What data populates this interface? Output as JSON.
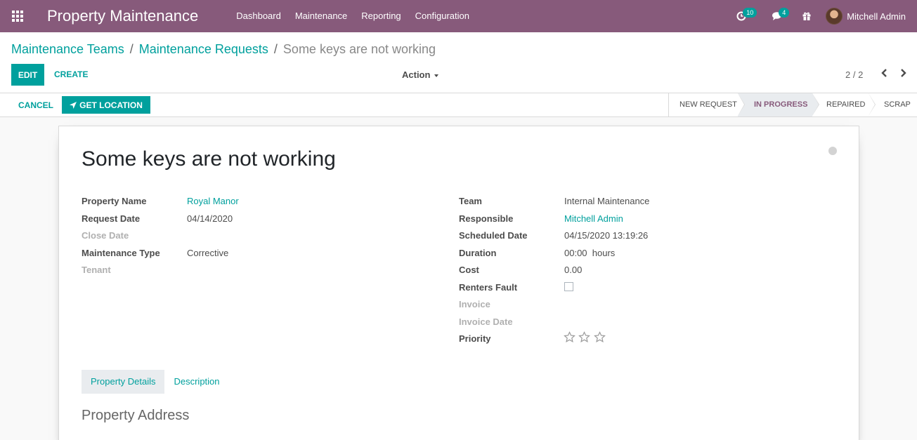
{
  "navbar": {
    "brand": "Property Maintenance",
    "menu": [
      {
        "label": "Dashboard"
      },
      {
        "label": "Maintenance"
      },
      {
        "label": "Reporting"
      },
      {
        "label": "Configuration"
      }
    ],
    "activities_count": "10",
    "messages_count": "4",
    "user_name": "Mitchell Admin"
  },
  "breadcrumb": {
    "item1": "Maintenance Teams",
    "item2": "Maintenance Requests",
    "current": "Some keys are not working",
    "separator": "/"
  },
  "buttons": {
    "edit": "EDIT",
    "create": "CREATE",
    "action": "Action",
    "cancel": "CANCEL",
    "get_location": "GET LOCATION"
  },
  "pager": "2 / 2",
  "stages": [
    {
      "label": "NEW REQUEST",
      "current": false
    },
    {
      "label": "IN PROGRESS",
      "current": true
    },
    {
      "label": "REPAIRED",
      "current": false
    },
    {
      "label": "SCRAP",
      "current": false
    }
  ],
  "record": {
    "title": "Some keys are not working",
    "left_fields": [
      {
        "label": "Property Name",
        "value": "Royal Manor",
        "link": true,
        "muted": false
      },
      {
        "label": "Request Date",
        "value": "04/14/2020",
        "link": false,
        "muted": false
      },
      {
        "label": "Close Date",
        "value": "",
        "link": false,
        "muted": true
      },
      {
        "label": "Maintenance Type",
        "value": "Corrective",
        "link": false,
        "muted": false
      },
      {
        "label": "Tenant",
        "value": "",
        "link": false,
        "muted": true
      }
    ],
    "right_fields": [
      {
        "label": "Team",
        "value": "Internal Maintenance",
        "link": false,
        "muted": false
      },
      {
        "label": "Responsible",
        "value": "Mitchell Admin",
        "link": true,
        "muted": false
      },
      {
        "label": "Scheduled Date",
        "value": "04/15/2020 13:19:26",
        "link": false,
        "muted": false
      },
      {
        "label": "Duration",
        "value": "00:00  hours",
        "link": false,
        "muted": false
      },
      {
        "label": "Cost",
        "value": "0.00",
        "link": false,
        "muted": false
      },
      {
        "label": "Renters Fault",
        "value": "",
        "link": false,
        "muted": false
      },
      {
        "label": "Invoice",
        "value": "",
        "link": false,
        "muted": true
      },
      {
        "label": "Invoice Date",
        "value": "",
        "link": false,
        "muted": true
      },
      {
        "label": "Priority",
        "value": "",
        "link": false,
        "muted": false
      }
    ],
    "renters_fault": false,
    "priority_stars": 0,
    "priority_max": 3
  },
  "tabs": [
    {
      "label": "Property Details",
      "active": true
    },
    {
      "label": "Description",
      "active": false
    }
  ],
  "section_title": "Property Address",
  "colors": {
    "brand": "#875a7b",
    "accent": "#00a09d"
  }
}
